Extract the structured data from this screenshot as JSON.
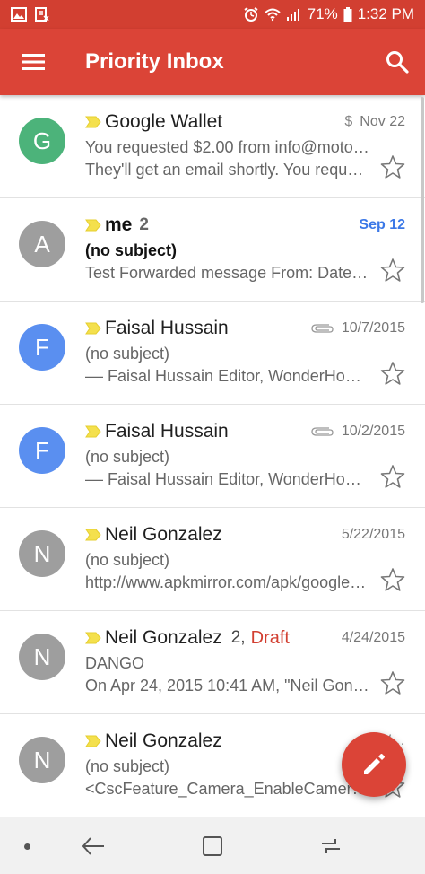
{
  "status_bar": {
    "battery": "71%",
    "time": "1:32 PM",
    "icons": [
      "image-icon",
      "clipboard-icon",
      "alarm-icon",
      "wifi-icon",
      "signal-icon",
      "battery-icon"
    ]
  },
  "app_bar": {
    "title": "Priority Inbox",
    "menu_icon": "hamburger-menu-icon",
    "search_icon": "search-icon",
    "color": "#db4437"
  },
  "emails": [
    {
      "avatar_letter": "G",
      "avatar_color": "#4cb37a",
      "sender": "Google Wallet",
      "count": "",
      "draft": "",
      "date": "Nov 22",
      "has_dollar": true,
      "dollar": "$",
      "has_attachment": false,
      "unread": false,
      "subject": "You requested $2.00 from info@moto…",
      "snippet": "They'll get an email shortly. You reques…"
    },
    {
      "avatar_letter": "A",
      "avatar_color": "#9e9e9e",
      "sender": "me",
      "count": "2",
      "draft": "",
      "date": "Sep 12",
      "has_dollar": false,
      "dollar": "",
      "has_attachment": false,
      "unread": true,
      "subject": "(no subject)",
      "snippet": "Test   Forwarded message   From: Date…"
    },
    {
      "avatar_letter": "F",
      "avatar_color": "#5a8ff0",
      "sender": "Faisal Hussain",
      "count": "",
      "draft": "",
      "date": "10/7/2015",
      "has_dollar": false,
      "dollar": "",
      "has_attachment": true,
      "unread": false,
      "subject": "(no subject)",
      "snippet": "–– Faisal Hussain Editor, WonderHowT…"
    },
    {
      "avatar_letter": "F",
      "avatar_color": "#5a8ff0",
      "sender": "Faisal Hussain",
      "count": "",
      "draft": "",
      "date": "10/2/2015",
      "has_dollar": false,
      "dollar": "",
      "has_attachment": true,
      "unread": false,
      "subject": "(no subject)",
      "snippet": "–– Faisal Hussain Editor, WonderHowT…"
    },
    {
      "avatar_letter": "N",
      "avatar_color": "#9e9e9e",
      "sender": "Neil Gonzalez",
      "count": "",
      "draft": "",
      "date": "5/22/2015",
      "has_dollar": false,
      "dollar": "",
      "has_attachment": false,
      "unread": false,
      "subject": "(no subject)",
      "snippet": "http://www.apkmirror.com/apk/google…"
    },
    {
      "avatar_letter": "N",
      "avatar_color": "#9e9e9e",
      "sender": "Neil Gonzalez",
      "count": "2,",
      "draft": "Draft",
      "date": "4/24/2015",
      "has_dollar": false,
      "dollar": "",
      "has_attachment": false,
      "unread": false,
      "subject": "DANGO",
      "snippet": "On Apr 24, 2015 10:41 AM, \"Neil Gonzal…"
    },
    {
      "avatar_letter": "N",
      "avatar_color": "#9e9e9e",
      "sender": "Neil Gonzalez",
      "count": "",
      "draft": "",
      "date": "4/…",
      "has_dollar": false,
      "dollar": "",
      "has_attachment": false,
      "unread": false,
      "subject": "(no subject)",
      "snippet": "<CscFeature_Camera_EnableCamera…"
    }
  ],
  "fab": {
    "icon": "pencil-compose-icon",
    "color": "#db4437"
  },
  "nav_bar": {
    "icons": [
      "nav-dot-icon",
      "back-icon",
      "home-icon",
      "recents-icon"
    ]
  }
}
